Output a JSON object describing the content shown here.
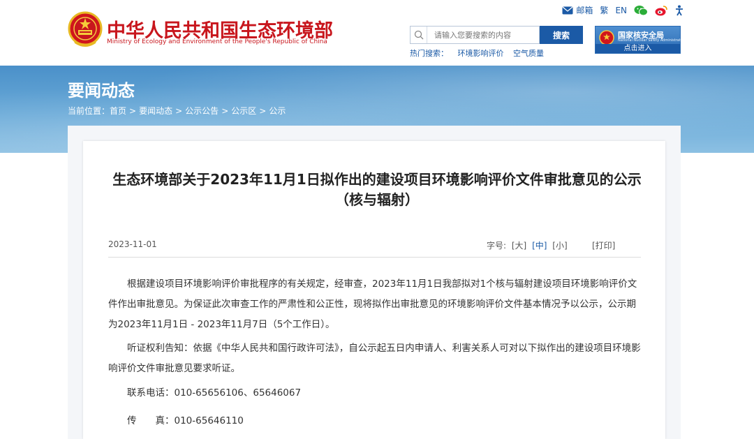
{
  "header": {
    "site_title": "中华人民共和国生态环境部",
    "site_subtitle": "Ministry of Ecology and Environment of the People's Republic of China",
    "top_links": {
      "mail": "邮箱",
      "traditional": "繁",
      "english": "EN"
    },
    "search": {
      "placeholder": "请输入您要搜索的内容",
      "button": "搜索",
      "hot_label": "热门搜索：",
      "hot_items": [
        "环境影响评价",
        "空气质量"
      ]
    },
    "nnsa": {
      "title": "国家核安全局",
      "subtitle": "National Nuclear Safety Administration",
      "enter": "点击进入"
    }
  },
  "banner": {
    "title": "要闻动态",
    "breadcrumb_label": "当前位置：",
    "crumbs": [
      "首页",
      "要闻动态",
      "公示公告",
      "公示区",
      "公示"
    ],
    "separator": ">"
  },
  "article": {
    "title": "生态环境部关于2023年11月1日拟作出的建设项目环境影响评价文件审批意见的公示（核与辐射）",
    "date": "2023-11-01",
    "font_label": "字号:",
    "font_sizes": [
      "[大]",
      "[中]",
      "[小]"
    ],
    "print": "[打印]",
    "paragraphs": [
      "根据建设项目环境影响评价审批程序的有关规定，经审查，2023年11月1日我部拟对1个核与辐射建设项目环境影响评价文件作出审批意见。为保证此次审查工作的严肃性和公正性，现将拟作出审批意见的环境影响评价文件基本情况予以公示，公示期为2023年11月1日 - 2023年11月7日（5个工作日）。",
      "听证权利告知：依据《中华人民共和国行政许可法》，自公示起五日内申请人、利害关系人可对以下拟作出的建设项目环境影响评价文件审批意见要求听证。",
      "联系电话：010-65656106、65646067",
      "传　　真：010-65646110"
    ]
  },
  "colors": {
    "brand_red": "#c8161d",
    "brand_blue": "#1b5aa6"
  }
}
